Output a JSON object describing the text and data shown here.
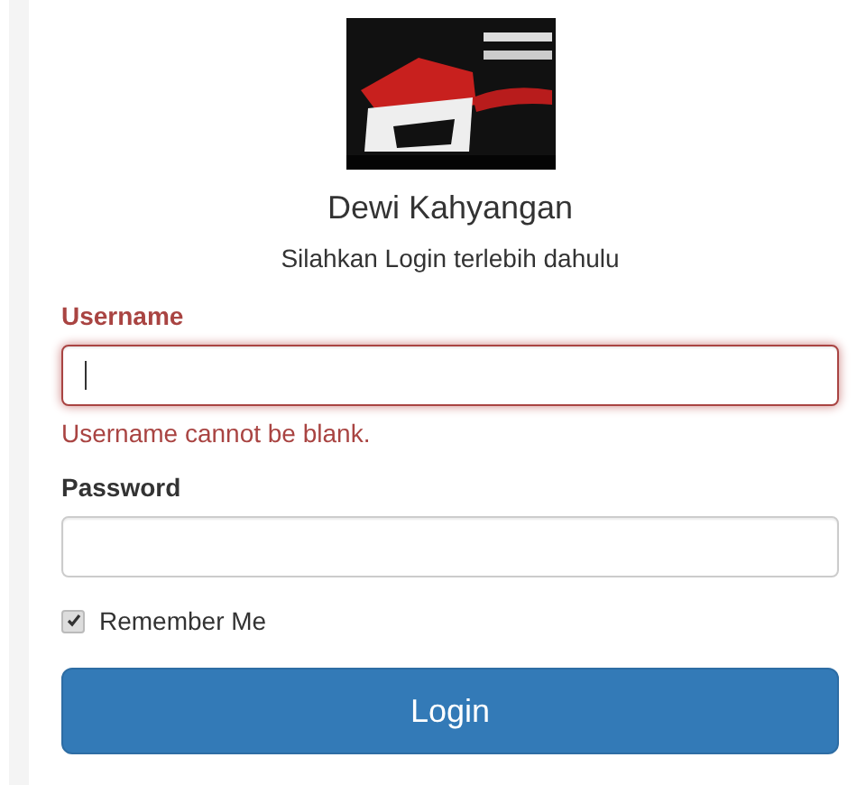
{
  "title": "Dewi Kahyangan",
  "subtitle": "Silahkan Login terlebih dahulu",
  "fields": [
    {
      "label": "Username",
      "has_error": true,
      "focused": true,
      "error": "Username cannot be blank."
    },
    {
      "label": "Password",
      "has_error": false,
      "focused": false
    }
  ],
  "remember": {
    "label": "Remember Me",
    "checked": true
  },
  "submit": "Login"
}
